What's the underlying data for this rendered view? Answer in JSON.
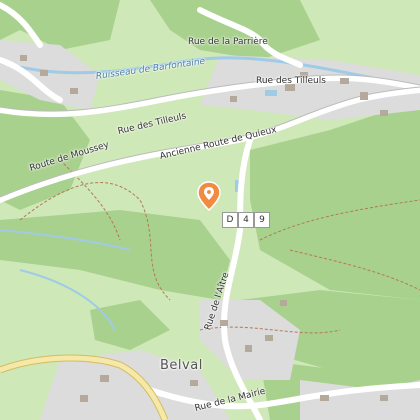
{
  "map": {
    "colors": {
      "forest": "#a9d18e",
      "meadow": "#cfe8b7",
      "residential": "#dcdcdc",
      "water": "#9fcbe6",
      "road_major": "#f6e8a6",
      "road_minor": "#ffffff",
      "path": "#b07a56",
      "pin": "#f28b42"
    },
    "labels": {
      "rue_parriere": "Rue de la Parrière",
      "ruisseau": "Ruisseau de Barfontaine",
      "rue_tilleuls_1": "Rue des Tilleuls",
      "rue_tilleuls_2": "Rue des Tilleuls",
      "route_moussey": "Route de Moussey",
      "ancienne_route": "Ancienne Route de Quieux",
      "rue_aitre": "Rue de l'Aître",
      "rue_mairie": "Rue de la Mairie",
      "belval": "Belval"
    },
    "road_numbers": [
      "D",
      "4",
      "9"
    ],
    "marker_icon": "map-pin-icon"
  }
}
